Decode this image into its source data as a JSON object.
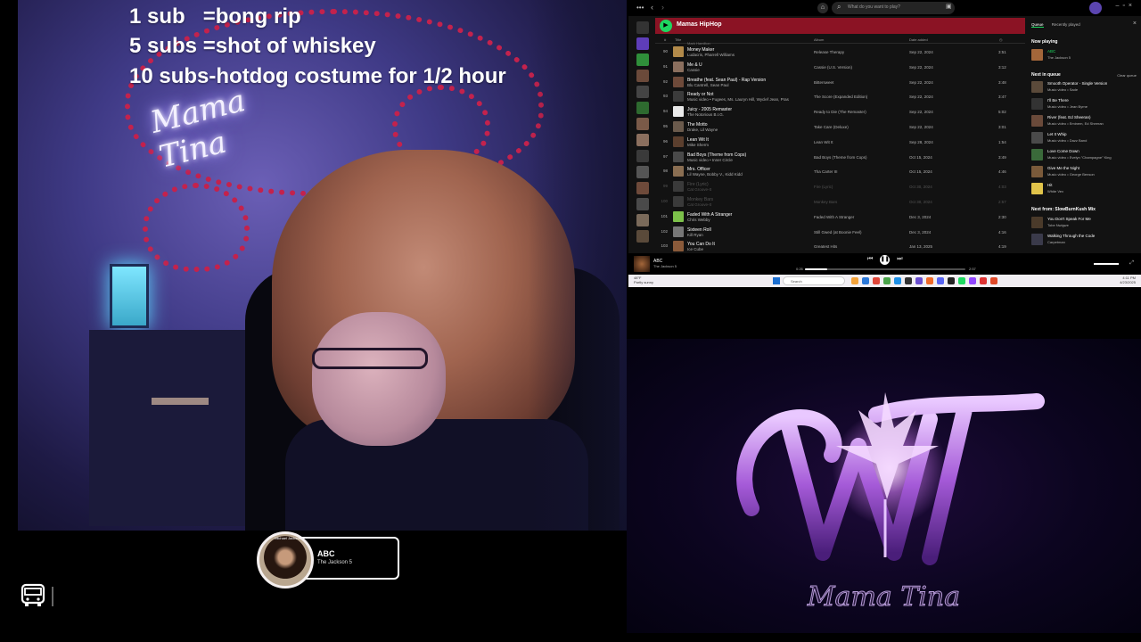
{
  "overlay": {
    "lines": [
      "1 sub   =bong rip",
      "5 subs =shot of whiskey",
      "10 subs-hotdog costume for 1/2 hour"
    ],
    "neon_sign": "Mama Tina"
  },
  "now_playing_card": {
    "title": "ABC",
    "artist": "The Jackson 5",
    "avatar_caption": "Michael Jackson"
  },
  "bottom_left": {
    "icon": "bus-icon"
  },
  "spotify": {
    "search_placeholder": "What do you want to play?",
    "playlist_title": "Mamas HipHop",
    "columns": {
      "num": "#",
      "title": "Title",
      "album": "Album",
      "date": "Date added"
    },
    "partial_row_artist": "Mark Hamilton",
    "rows": [
      {
        "num": "90",
        "title": "Money Maker",
        "artist": "Ludacris, Pharrell Williams",
        "album": "Release Therapy",
        "date": "Sep 22, 2024",
        "duration": "3:51",
        "color": "#b28a4a"
      },
      {
        "num": "91",
        "title": "Me & U",
        "artist": "Cassie",
        "album": "Cassie (U.S. Version)",
        "date": "Sep 22, 2024",
        "duration": "3:12",
        "color": "#8b6f5e"
      },
      {
        "num": "92",
        "title": "Breathe (feat. Sean Paul) - Rap Version",
        "artist": "Blu Cantrell, Sean Paul",
        "album": "Bittersweet",
        "date": "Sep 22, 2024",
        "duration": "3:48",
        "color": "#6e4a3a"
      },
      {
        "num": "93",
        "title": "Ready or Not",
        "artist": "Music video • Fugees, Ms. Lauryn Hill, Wyclef Jean, Pras",
        "album": "The Score (Expanded Edition)",
        "date": "Sep 22, 2024",
        "duration": "3:47",
        "color": "#3b3b3b"
      },
      {
        "num": "94",
        "title": "Juicy - 2005 Remaster",
        "artist": "The Notorious B.I.G.",
        "album": "Ready to Die (The Remaster)",
        "date": "Sep 22, 2024",
        "duration": "5:02",
        "color": "#e9e9e9"
      },
      {
        "num": "95",
        "title": "The Motto",
        "artist": "Drake, Lil Wayne",
        "album": "Take Care (Deluxe)",
        "date": "Sep 22, 2024",
        "duration": "3:01",
        "color": "#6a5a4c"
      },
      {
        "num": "96",
        "title": "Lean Wit It",
        "artist": "Mike Sherm",
        "album": "Lean Wit It",
        "date": "Sep 28, 2024",
        "duration": "1:54",
        "color": "#5b3f2e"
      },
      {
        "num": "97",
        "title": "Bad Boys (Theme from Cops)",
        "artist": "Music video • Inner Circle",
        "album": "Bad Boys (Theme from Cops)",
        "date": "Oct 15, 2024",
        "duration": "3:49",
        "color": "#4a4a4a"
      },
      {
        "num": "98",
        "title": "Mrs. Officer",
        "artist": "Lil Wayne, Bobby V., Kidd Kidd",
        "album": "Tha Carter III",
        "date": "Oct 15, 2024",
        "duration": "4:46",
        "color": "#8a6e52"
      },
      {
        "num": "99",
        "title": "Fire (Lyric)",
        "artist": "Cat Groove-It",
        "album": "Fire (Lyric)",
        "date": "Oct 30, 2024",
        "duration": "4:03",
        "color": "#3a3a3a",
        "dim": true
      },
      {
        "num": "100",
        "title": "Monkey Bars",
        "artist": "Cat Groove-It",
        "album": "Monkey Bars",
        "date": "Oct 30, 2024",
        "duration": "2:57",
        "color": "#3a3a3a",
        "dim": true
      },
      {
        "num": "101",
        "title": "Faded With A Stranger",
        "artist": "Chris Webby",
        "album": "Faded With A Stranger",
        "date": "Dec 3, 2024",
        "duration": "2:30",
        "color": "#7cc04a"
      },
      {
        "num": "102",
        "title": "Sixteen Roll",
        "artist": "Kill Ryan",
        "album": "Still Gwed (at Boonie Feel)",
        "date": "Dec 3, 2024",
        "duration": "4:16",
        "color": "#777777"
      },
      {
        "num": "103",
        "title": "You Can Do It",
        "artist": "Ice Cube",
        "album": "Greatest Hits",
        "date": "Jan 13, 2025",
        "duration": "4:19",
        "color": "#8a5a3a"
      }
    ],
    "queue": {
      "tabs": [
        "Queue",
        "Recently played"
      ],
      "now_playing_label": "Now playing",
      "now_playing": {
        "title": "ABC",
        "artist": "The Jackson 5"
      },
      "next_label": "Next in queue",
      "clear_label": "Clear queue",
      "next": [
        {
          "title": "Smooth Operator - Single Version",
          "artist": "Music video • Sade"
        },
        {
          "title": "I'll Be There",
          "artist": "Music video • Jean Byrne"
        },
        {
          "title": "River (feat. Ed Sheeran)",
          "artist": "Music video • Eminem, Ed Sheeran"
        },
        {
          "title": "Let It Whip",
          "artist": "Music video • Dazz Band"
        },
        {
          "title": "Love Come Down",
          "artist": "Music video • Evelyn \"Champagne\" King"
        },
        {
          "title": "Give Me the Night",
          "artist": "Music video • George Benson"
        },
        {
          "title": "Hit",
          "artist": "White Vex"
        }
      ],
      "next_from_label": "Next from: SlowBurnKush Mix",
      "next_from": [
        {
          "title": "You Don't Speak For Me",
          "artist": "Tobe Nwigwe"
        },
        {
          "title": "Walking Through the Code",
          "artist": "Carpetman"
        }
      ]
    },
    "player": {
      "title": "ABC",
      "artist": "The Jackson 5",
      "elapsed": "0:26",
      "total": "2:57",
      "progress_fraction": 0.14
    }
  },
  "taskbar": {
    "weather_temp": "48°F",
    "weather_desc": "Partly sunny",
    "search": "Search",
    "time": "4:11 PM",
    "date": "4/23/2025"
  },
  "logo": {
    "text": "Mama Tina"
  }
}
